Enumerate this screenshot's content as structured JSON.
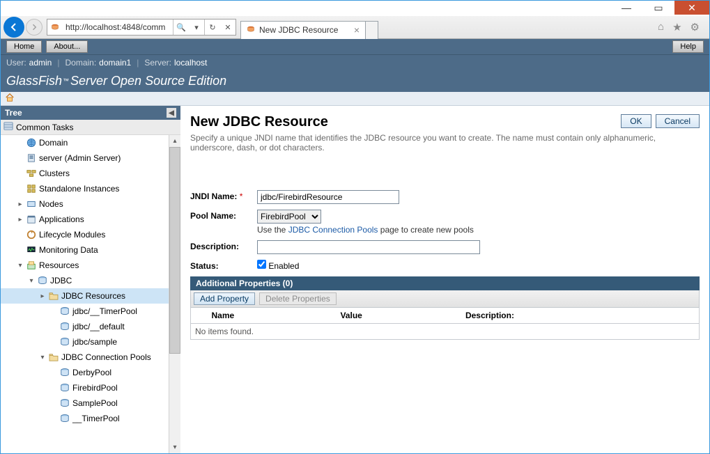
{
  "window": {
    "url": "http://localhost:4848/comm",
    "tab_title": "New JDBC Resource"
  },
  "app_nav": {
    "home": "Home",
    "about": "About...",
    "help": "Help"
  },
  "info": {
    "user_label": "User:",
    "user": "admin",
    "domain_label": "Domain:",
    "domain": "domain1",
    "server_label": "Server:",
    "server": "localhost"
  },
  "brand": {
    "prefix": "GlassFish",
    "tm": "™",
    "rest": " Server Open Source Edition"
  },
  "tree": {
    "header": "Tree",
    "root": "Common Tasks",
    "items": [
      {
        "label": "Domain",
        "icon": "globe",
        "indent": 1,
        "arrow": ""
      },
      {
        "label": "server (Admin Server)",
        "icon": "server",
        "indent": 1,
        "arrow": ""
      },
      {
        "label": "Clusters",
        "icon": "cluster",
        "indent": 1,
        "arrow": ""
      },
      {
        "label": "Standalone Instances",
        "icon": "instances",
        "indent": 1,
        "arrow": ""
      },
      {
        "label": "Nodes",
        "icon": "node",
        "indent": 1,
        "arrow": "right"
      },
      {
        "label": "Applications",
        "icon": "apps",
        "indent": 1,
        "arrow": "right"
      },
      {
        "label": "Lifecycle Modules",
        "icon": "lifecycle",
        "indent": 1,
        "arrow": ""
      },
      {
        "label": "Monitoring Data",
        "icon": "monitor",
        "indent": 1,
        "arrow": ""
      },
      {
        "label": "Resources",
        "icon": "resources",
        "indent": 1,
        "arrow": "down"
      },
      {
        "label": "JDBC",
        "icon": "db",
        "indent": 2,
        "arrow": "down"
      },
      {
        "label": "JDBC Resources",
        "icon": "folder",
        "indent": 3,
        "arrow": "right",
        "selected": true
      },
      {
        "label": "jdbc/__TimerPool",
        "icon": "db",
        "indent": 4,
        "arrow": ""
      },
      {
        "label": "jdbc/__default",
        "icon": "db",
        "indent": 4,
        "arrow": ""
      },
      {
        "label": "jdbc/sample",
        "icon": "db",
        "indent": 4,
        "arrow": ""
      },
      {
        "label": "JDBC Connection Pools",
        "icon": "folder",
        "indent": 3,
        "arrow": "down"
      },
      {
        "label": "DerbyPool",
        "icon": "db",
        "indent": 4,
        "arrow": ""
      },
      {
        "label": "FirebirdPool",
        "icon": "db",
        "indent": 4,
        "arrow": ""
      },
      {
        "label": "SamplePool",
        "icon": "db",
        "indent": 4,
        "arrow": ""
      },
      {
        "label": "__TimerPool",
        "icon": "db",
        "indent": 4,
        "arrow": ""
      }
    ]
  },
  "page": {
    "title": "New JDBC Resource",
    "subtitle": "Specify a unique JNDI name that identifies the JDBC resource you want to create. The name must contain only alphanumeric, underscore, dash, or dot characters.",
    "ok": "OK",
    "cancel": "Cancel",
    "form": {
      "jndi_label": "JNDI Name:",
      "jndi_value": "jdbc/FirebirdResource",
      "pool_label": "Pool Name:",
      "pool_value": "FirebirdPool",
      "pool_hint_pre": "Use the ",
      "pool_hint_link": "JDBC Connection Pools",
      "pool_hint_post": " page to create new pools",
      "desc_label": "Description:",
      "desc_value": "",
      "status_label": "Status:",
      "status_text": "Enabled"
    },
    "section": "Additional Properties (0)",
    "add_property": "Add Property",
    "delete_properties": "Delete Properties",
    "th_name": "Name",
    "th_value": "Value",
    "th_desc": "Description:",
    "empty": "No items found."
  }
}
